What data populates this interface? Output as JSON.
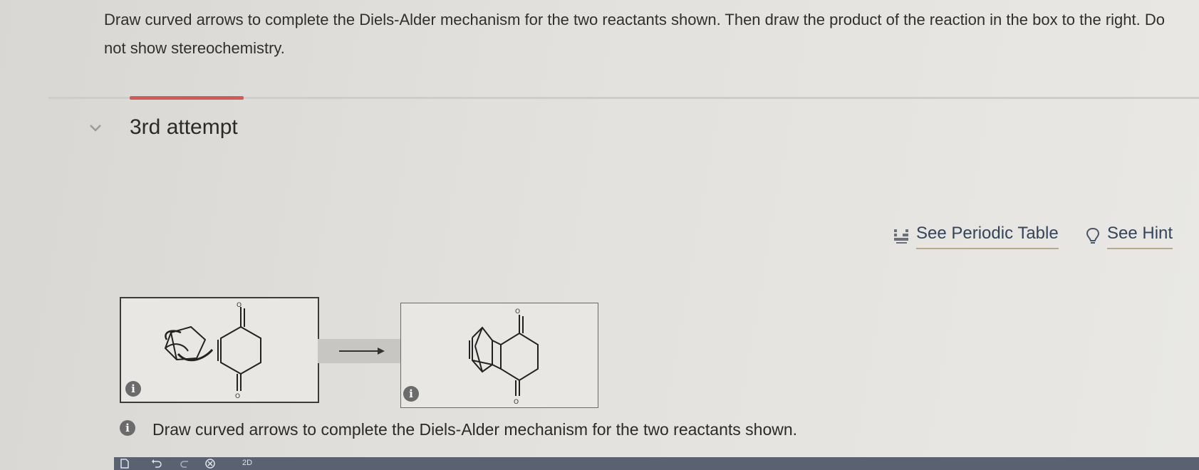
{
  "question": {
    "text": "Draw curved arrows to complete the Diels-Alder mechanism for the two reactants shown. Then draw the product of the reaction in the box to the right. Do not show stereochemistry."
  },
  "attempt": {
    "label": "3rd attempt"
  },
  "tools": {
    "periodic_table": "See Periodic Table",
    "hint": "See Hint"
  },
  "reaction": {
    "reactant_box": {
      "oxygen_top": "O",
      "oxygen_bottom": "O"
    },
    "product_box": {
      "oxygen_top": "O",
      "oxygen_bottom": "O"
    },
    "info_icon": "i"
  },
  "instruction": {
    "text": "Draw curved arrows to complete the Diels-Alder mechanism for the two reactants shown."
  },
  "toolbar": {
    "mode": "2D"
  },
  "colors": {
    "accent": "#cf5b57",
    "link_underline": "#b9a98a",
    "link_text": "#34455a"
  }
}
